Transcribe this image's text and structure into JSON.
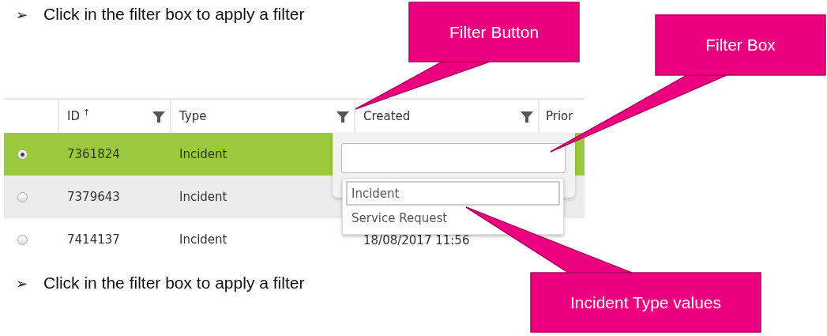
{
  "instructions": [
    {
      "bullet": "➢",
      "text": "Click in the filter box  to apply a filter"
    },
    {
      "bullet": "➢",
      "text": "Click in the filter box  to apply a filter"
    }
  ],
  "table": {
    "columns": [
      {
        "label": "ID",
        "sort": "↑",
        "filter": true
      },
      {
        "label": "Type",
        "filter": true
      },
      {
        "label": "Created",
        "filter": true
      },
      {
        "label": "Prior",
        "filter": false
      }
    ],
    "rows": [
      {
        "selected": true,
        "cells": [
          "7361824",
          "Incident",
          "",
          ""
        ]
      },
      {
        "selected": false,
        "cells": [
          "7379643",
          "Incident",
          "",
          ""
        ]
      },
      {
        "selected": false,
        "cells": [
          "7414137",
          "Incident",
          "18/08/2017 11:56",
          ""
        ]
      }
    ]
  },
  "filter_popup": {
    "options": [
      {
        "label": "Incident",
        "selected": true
      },
      {
        "label": "Service Request",
        "selected": false
      }
    ]
  },
  "callouts": [
    {
      "label": "Filter Button"
    },
    {
      "label": "Filter Box"
    },
    {
      "label": "Incident Type values"
    }
  ]
}
